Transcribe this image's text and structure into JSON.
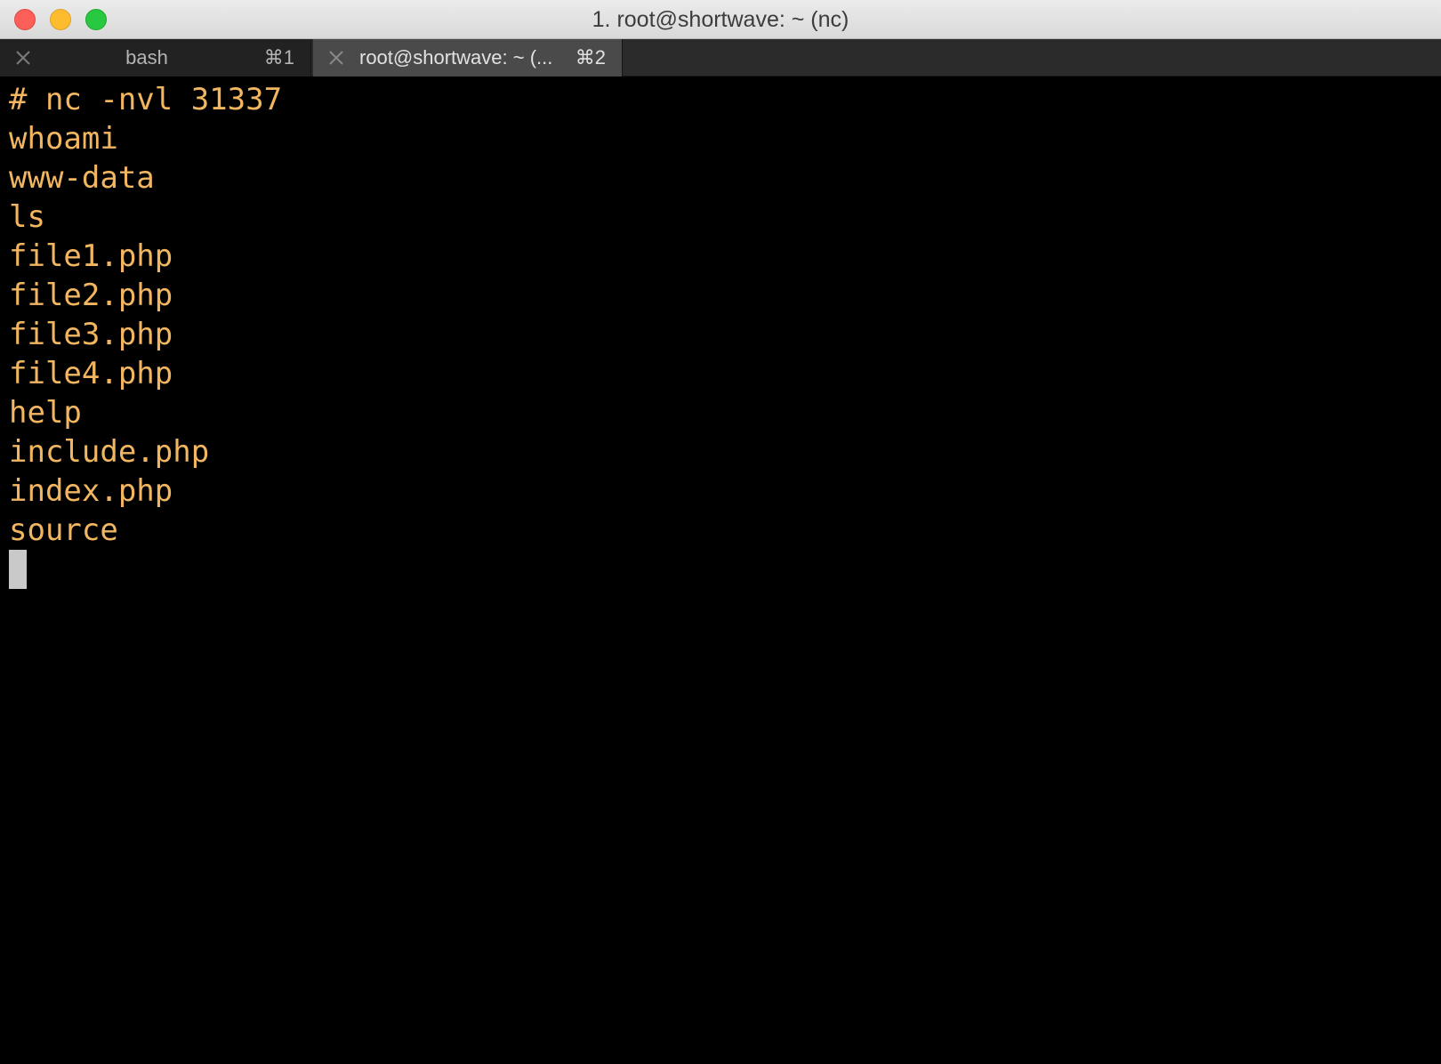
{
  "window": {
    "title": "1. root@shortwave: ~ (nc)"
  },
  "tabs": [
    {
      "label": "bash",
      "shortcut": "⌘1",
      "active": false
    },
    {
      "label": "root@shortwave: ~ (...",
      "shortcut": "⌘2",
      "active": true
    }
  ],
  "terminal": {
    "lines": [
      "# nc -nvl 31337",
      "whoami",
      "www-data",
      "ls",
      "file1.php",
      "file2.php",
      "file3.php",
      "file4.php",
      "help",
      "include.php",
      "index.php",
      "source"
    ]
  },
  "colors": {
    "terminal_text": "#f2b661",
    "terminal_background": "#000000",
    "cursor": "#c9c9c9",
    "close_button": "#fc5f57",
    "minimize_button": "#fdbc2e",
    "zoom_button": "#28c840"
  },
  "icons": {
    "tab_close": "close-icon"
  }
}
